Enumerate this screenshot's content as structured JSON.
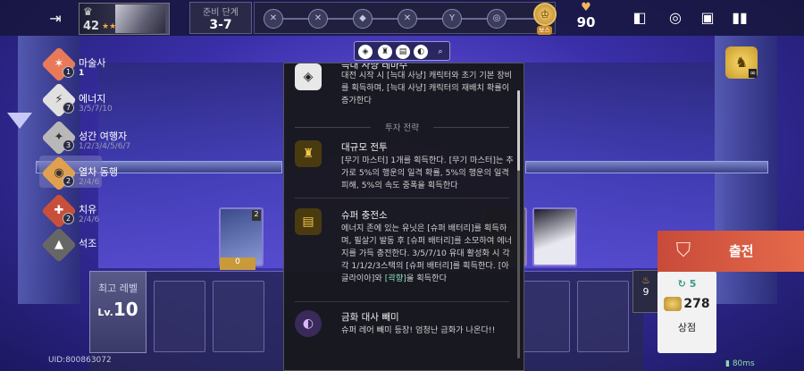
{
  "topbar": {
    "player_level": "42",
    "stage_label": "준비 단계",
    "stage_value": "3-7",
    "stage_nodes": [
      "✕",
      "✕",
      "◆",
      "✕",
      "Y",
      "◎"
    ],
    "boss_tag": "보스",
    "hearts": "90"
  },
  "traits": [
    {
      "name": "마술사",
      "count": "1",
      "tiers_active": "1",
      "tiers_rest": "",
      "color": "#e87a5a",
      "icon": "✶"
    },
    {
      "name": "에너지",
      "count": "7",
      "tiers_active": "3/5/7/10",
      "tiers_rest": "",
      "color": "#e0e0e0",
      "icon": "⚡"
    },
    {
      "name": "성간 여행자",
      "count": "3",
      "tiers_active": "1/2/3/4/5/6/7",
      "tiers_rest": "",
      "color": "#b8b8b8",
      "icon": "✦"
    },
    {
      "name": "열차 동행",
      "count": "2",
      "tiers_active": "2/4/6",
      "tiers_rest": "",
      "color": "#e0a050",
      "icon": "◉"
    },
    {
      "name": "치유",
      "count": "2",
      "tiers_active": "2/4/6",
      "tiers_rest": "",
      "color": "#c8503a",
      "icon": "✚"
    },
    {
      "name": "석조",
      "count": "",
      "tiers_active": "",
      "tiers_rest": "",
      "color": "#666",
      "icon": "▲"
    }
  ],
  "popup": {
    "entry1": {
      "title": "늑대 사냥 테마주",
      "desc": "대전 시작 시 [늑대 사냥] 캐릭터와 초기 기본 장비를 획득하며, [늑대 사냥] 캐릭터의 재배치 확률이 증가한다"
    },
    "section_label": "투자 전략",
    "entry2": {
      "title": "대규모 전투",
      "desc": "[무기 마스터] 1개를 획득한다. [무기 마스터]는 추가로 5%의 행운의 일격 확률, 5%의 행운의 일격 피해, 5%의 속도 중폭을 획득한다"
    },
    "entry3": {
      "title": "슈퍼 충전소",
      "desc_a": "에너지 존에 있는 유닛은 [슈퍼 배터리]를 획득하며, 필살기 발동 후 [슈퍼 배터리]를 소모하여 에너지를 가득 충전한다. 3/5/7/10 유대 활성화 시 각각 1/1/2/3스택의 [슈퍼 배터리]를 획득한다. [아글라이아]와 ",
      "desc_hl": "[곽향]",
      "desc_b": "을 획득한다"
    },
    "entry4": {
      "title": "금화 대사 빼미",
      "desc": "슈퍼 레어 빼미 등장! 엄청난 금화가 나온다!!"
    }
  },
  "shop_cards": [
    {
      "cost": "2",
      "color": "#3a4a8a"
    },
    {
      "cost": "",
      "color": "#5a4a3a"
    },
    {
      "cost": "",
      "color": "#e8e8f0"
    }
  ],
  "item_chip": "0",
  "bench": {
    "level_label": "최고 레벨",
    "level_prefix": "Lv.",
    "level_value": "10"
  },
  "uid": "UID:800863072",
  "coins": {
    "count": "9"
  },
  "shop": {
    "reroll": "5",
    "gold": "278",
    "label": "상점"
  },
  "deploy_label": "출전",
  "ping": "80ms",
  "colors": {
    "accent": "#e46a4a",
    "gold": "#f4a93a",
    "highlight": "#8de0b8"
  }
}
